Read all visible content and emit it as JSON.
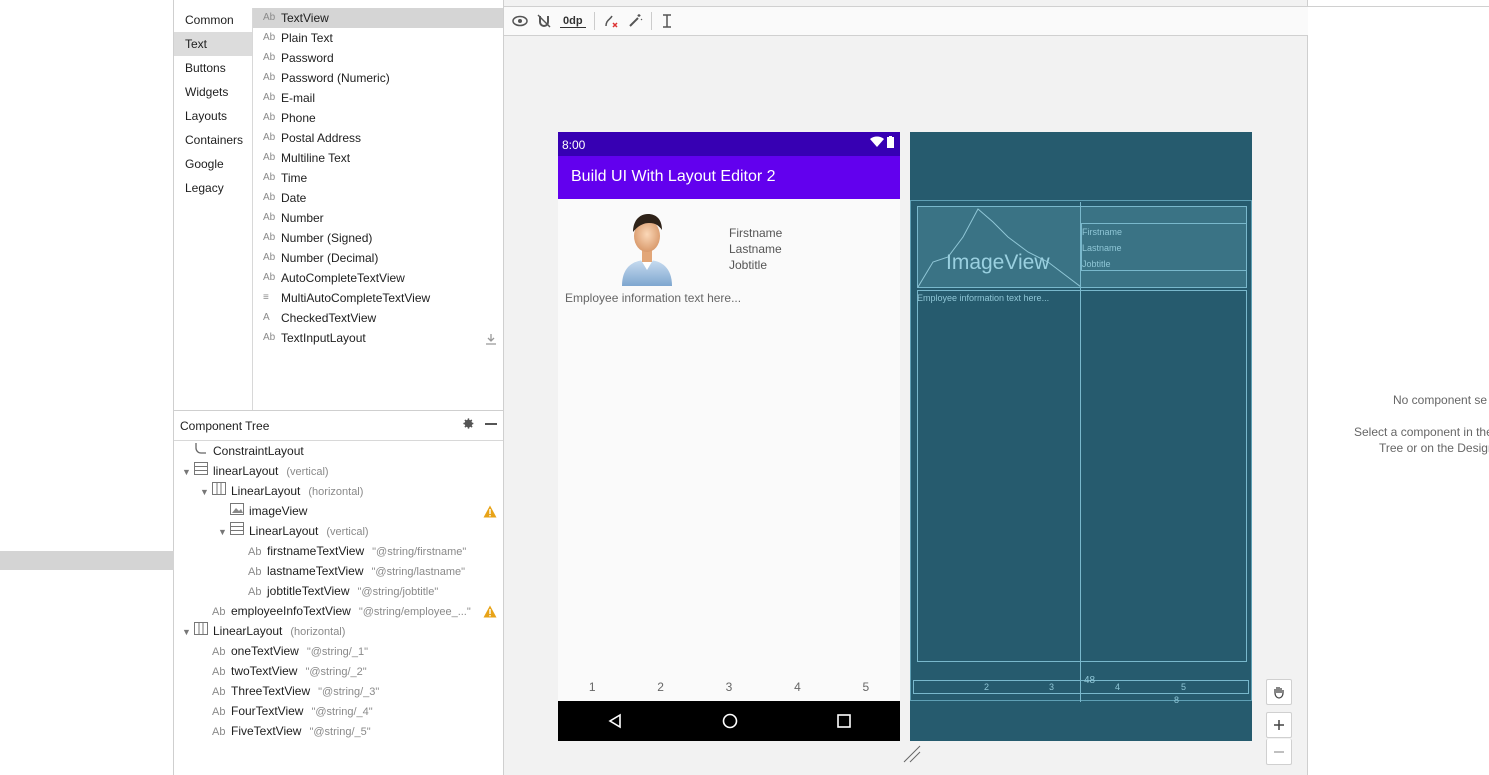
{
  "palette": {
    "categories": [
      "Common",
      "Text",
      "Buttons",
      "Widgets",
      "Layouts",
      "Containers",
      "Google",
      "Legacy"
    ],
    "selected_category": "Text",
    "items": [
      {
        "icon": "Ab",
        "label": "TextView"
      },
      {
        "icon": "Ab",
        "label": "Plain Text"
      },
      {
        "icon": "Ab",
        "label": "Password"
      },
      {
        "icon": "Ab",
        "label": "Password (Numeric)"
      },
      {
        "icon": "Ab",
        "label": "E-mail"
      },
      {
        "icon": "Ab",
        "label": "Phone"
      },
      {
        "icon": "Ab",
        "label": "Postal Address"
      },
      {
        "icon": "Ab",
        "label": "Multiline Text"
      },
      {
        "icon": "Ab",
        "label": "Time"
      },
      {
        "icon": "Ab",
        "label": "Date"
      },
      {
        "icon": "Ab",
        "label": "Number"
      },
      {
        "icon": "Ab",
        "label": "Number (Signed)"
      },
      {
        "icon": "Ab",
        "label": "Number (Decimal)"
      },
      {
        "icon": "Ab",
        "label": "AutoCompleteTextView"
      },
      {
        "icon": "≡",
        "label": "MultiAutoCompleteTextView"
      },
      {
        "icon": "A",
        "label": "CheckedTextView"
      },
      {
        "icon": "Ab",
        "label": "TextInputLayout"
      }
    ]
  },
  "component_tree": {
    "title": "Component Tree",
    "rows": [
      {
        "name": "ConstraintLayout",
        "attr": ""
      },
      {
        "name": "linearLayout",
        "attr": "(vertical)"
      },
      {
        "name": "LinearLayout",
        "attr": "(horizontal)"
      },
      {
        "name": "imageView",
        "attr": ""
      },
      {
        "name": "LinearLayout",
        "attr": "(vertical)"
      },
      {
        "name": "firstnameTextView",
        "attr": "\"@string/firstname\""
      },
      {
        "name": "lastnameTextView",
        "attr": "\"@string/lastname\""
      },
      {
        "name": "jobtitleTextView",
        "attr": "\"@string/jobtitle\""
      },
      {
        "name": "employeeInfoTextView",
        "attr": "\"@string/employee_...\""
      },
      {
        "name": "LinearLayout",
        "attr": "(horizontal)"
      },
      {
        "name": "oneTextView",
        "attr": "\"@string/_1\""
      },
      {
        "name": "twoTextView",
        "attr": "\"@string/_2\""
      },
      {
        "name": "ThreeTextView",
        "attr": "\"@string/_3\""
      },
      {
        "name": "FourTextView",
        "attr": "\"@string/_4\""
      },
      {
        "name": "FiveTextView",
        "attr": "\"@string/_5\""
      }
    ]
  },
  "toolbar": {
    "margin_value": "0dp"
  },
  "device": {
    "time": "8:00",
    "app_title": "Build UI With Layout Editor 2",
    "firstname": "Firstname",
    "lastname": "Lastname",
    "jobtitle": "Jobtitle",
    "employee_info": "Employee information text here...",
    "numbers": [
      "1",
      "2",
      "3",
      "4",
      "5"
    ]
  },
  "blueprint": {
    "image_label": "ImageView",
    "firstname": "Firstname",
    "lastname": "Lastname",
    "jobtitle": "Jobtitle",
    "employee_info": "Employee information text here...",
    "margin_48": "48",
    "margin_8": "8",
    "tick_2": "2",
    "tick_3": "3",
    "tick_4": "4",
    "tick_5": "5"
  },
  "attributes": {
    "no_selection": "No component se",
    "hint_line1": "Select a component in the",
    "hint_line2": "Tree or on the Design"
  },
  "colors": {
    "status": "#3700b3",
    "appbar": "#6200ee",
    "blueprint": "#265b6e",
    "warning": "#e8a317"
  }
}
